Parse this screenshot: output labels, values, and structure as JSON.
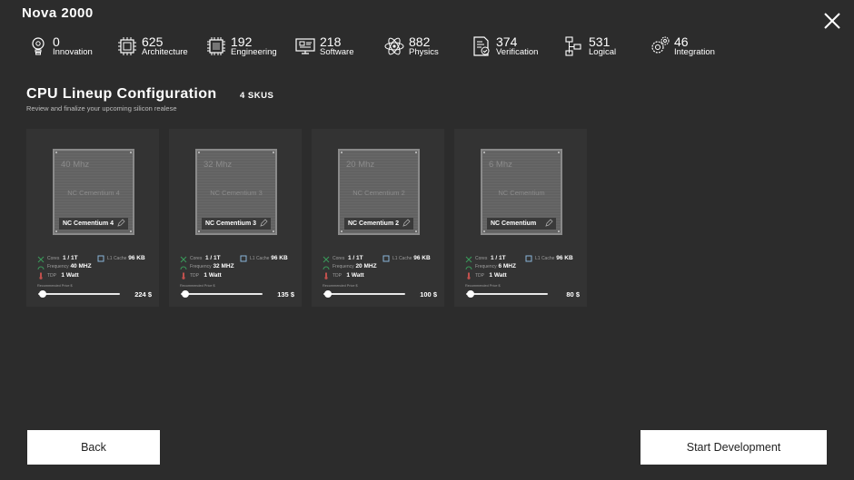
{
  "app_title": "Nova 2000",
  "stats": [
    {
      "value": "0",
      "label": "Innovation",
      "icon": "lightbulb-gear-icon"
    },
    {
      "value": "625",
      "label": "Architecture",
      "icon": "chip-icon"
    },
    {
      "value": "192",
      "label": "Engineering",
      "icon": "processor-icon"
    },
    {
      "value": "218",
      "label": "Software",
      "icon": "monitor-code-icon"
    },
    {
      "value": "882",
      "label": "Physics",
      "icon": "atom-icon"
    },
    {
      "value": "374",
      "label": "Verification",
      "icon": "document-check-icon"
    },
    {
      "value": "531",
      "label": "Logical",
      "icon": "flowchart-icon"
    },
    {
      "value": "46",
      "label": "Integration",
      "icon": "gears-icon"
    }
  ],
  "section": {
    "title": "CPU Lineup Configuration",
    "sku_count": "4 SKUS",
    "subtitle": "Review and finalize your upcoming silicon realese"
  },
  "spec_labels": {
    "cores": "Cores",
    "cache": "L1 Cache",
    "frequency": "Frequency",
    "tdp": "TDP",
    "price": "Recommended Price $"
  },
  "cards": [
    {
      "chip_freq": "40 Mhz",
      "chip_model": "NC Cementium 4",
      "name": "NC Cementium 4",
      "cores": "1 / 1T",
      "cache": "96 KB",
      "frequency": "40 MHZ",
      "tdp": "1 Watt",
      "price": "224 $",
      "slider_fraction": 0.05
    },
    {
      "chip_freq": "32 Mhz",
      "chip_model": "NC Cementium 3",
      "name": "NC Cementium 3",
      "cores": "1 / 1T",
      "cache": "96 KB",
      "frequency": "32 MHZ",
      "tdp": "1 Watt",
      "price": "135 $",
      "slider_fraction": 0.05
    },
    {
      "chip_freq": "20 Mhz",
      "chip_model": "NC Cementium 2",
      "name": "NC Cementium 2",
      "cores": "1 / 1T",
      "cache": "96 KB",
      "frequency": "20 MHZ",
      "tdp": "1 Watt",
      "price": "100 $",
      "slider_fraction": 0.05
    },
    {
      "chip_freq": "6 Mhz",
      "chip_model": "NC Cementium",
      "name": "NC Cementium",
      "cores": "1 / 1T",
      "cache": "96 KB",
      "frequency": "6 MHZ",
      "tdp": "1 Watt",
      "price": "80 $",
      "slider_fraction": 0.05
    }
  ],
  "buttons": {
    "back": "Back",
    "start": "Start Development"
  },
  "colors": {
    "background": "#2c2c2c",
    "card": "#333333",
    "chip": "#626262",
    "cores_icon": "#3a9a5a",
    "frequency_icon": "#3a9a5a",
    "tdp_icon": "#c0504d",
    "cache_icon": "#8ab4d8"
  }
}
